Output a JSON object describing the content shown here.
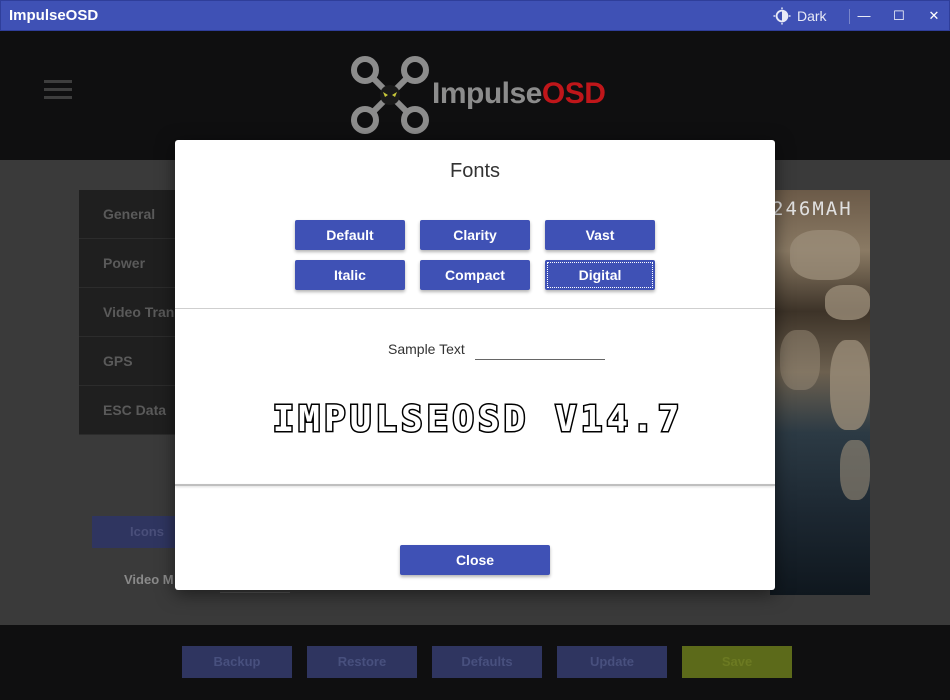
{
  "window": {
    "title": "ImpulseOSD",
    "theme_label": "Dark",
    "minimize_glyph": "—",
    "maximize_glyph": "☐",
    "close_glyph": "✕"
  },
  "logo": {
    "text_main": "Impulse",
    "text_accent": "OSD",
    "accent_color": "#c0161a"
  },
  "sidebar": {
    "items": [
      {
        "label": "General"
      },
      {
        "label": "Power"
      },
      {
        "label": "Video Tran"
      },
      {
        "label": "GPS"
      },
      {
        "label": "ESC Data"
      }
    ]
  },
  "content": {
    "icons_tab": "Icons",
    "video_mode_label": "Video M",
    "osd_readout": "246MAH"
  },
  "footer": {
    "buttons": {
      "backup": "Backup",
      "restore": "Restore",
      "defaults": "Defaults",
      "update": "Update",
      "save": "Save"
    }
  },
  "fonts_dialog": {
    "title": "Fonts",
    "font_buttons": [
      "Default",
      "Clarity",
      "Vast",
      "Italic",
      "Compact",
      "Digital"
    ],
    "focused_font": "Digital",
    "sample_label": "Sample Text",
    "sample_value": "",
    "preview_text": "IMPULSEOSD V14.7",
    "close_label": "Close"
  },
  "colors": {
    "primary": "#3f51b5",
    "titlebar": "#3f51b5",
    "overlay_dark": "#0f0f10"
  }
}
